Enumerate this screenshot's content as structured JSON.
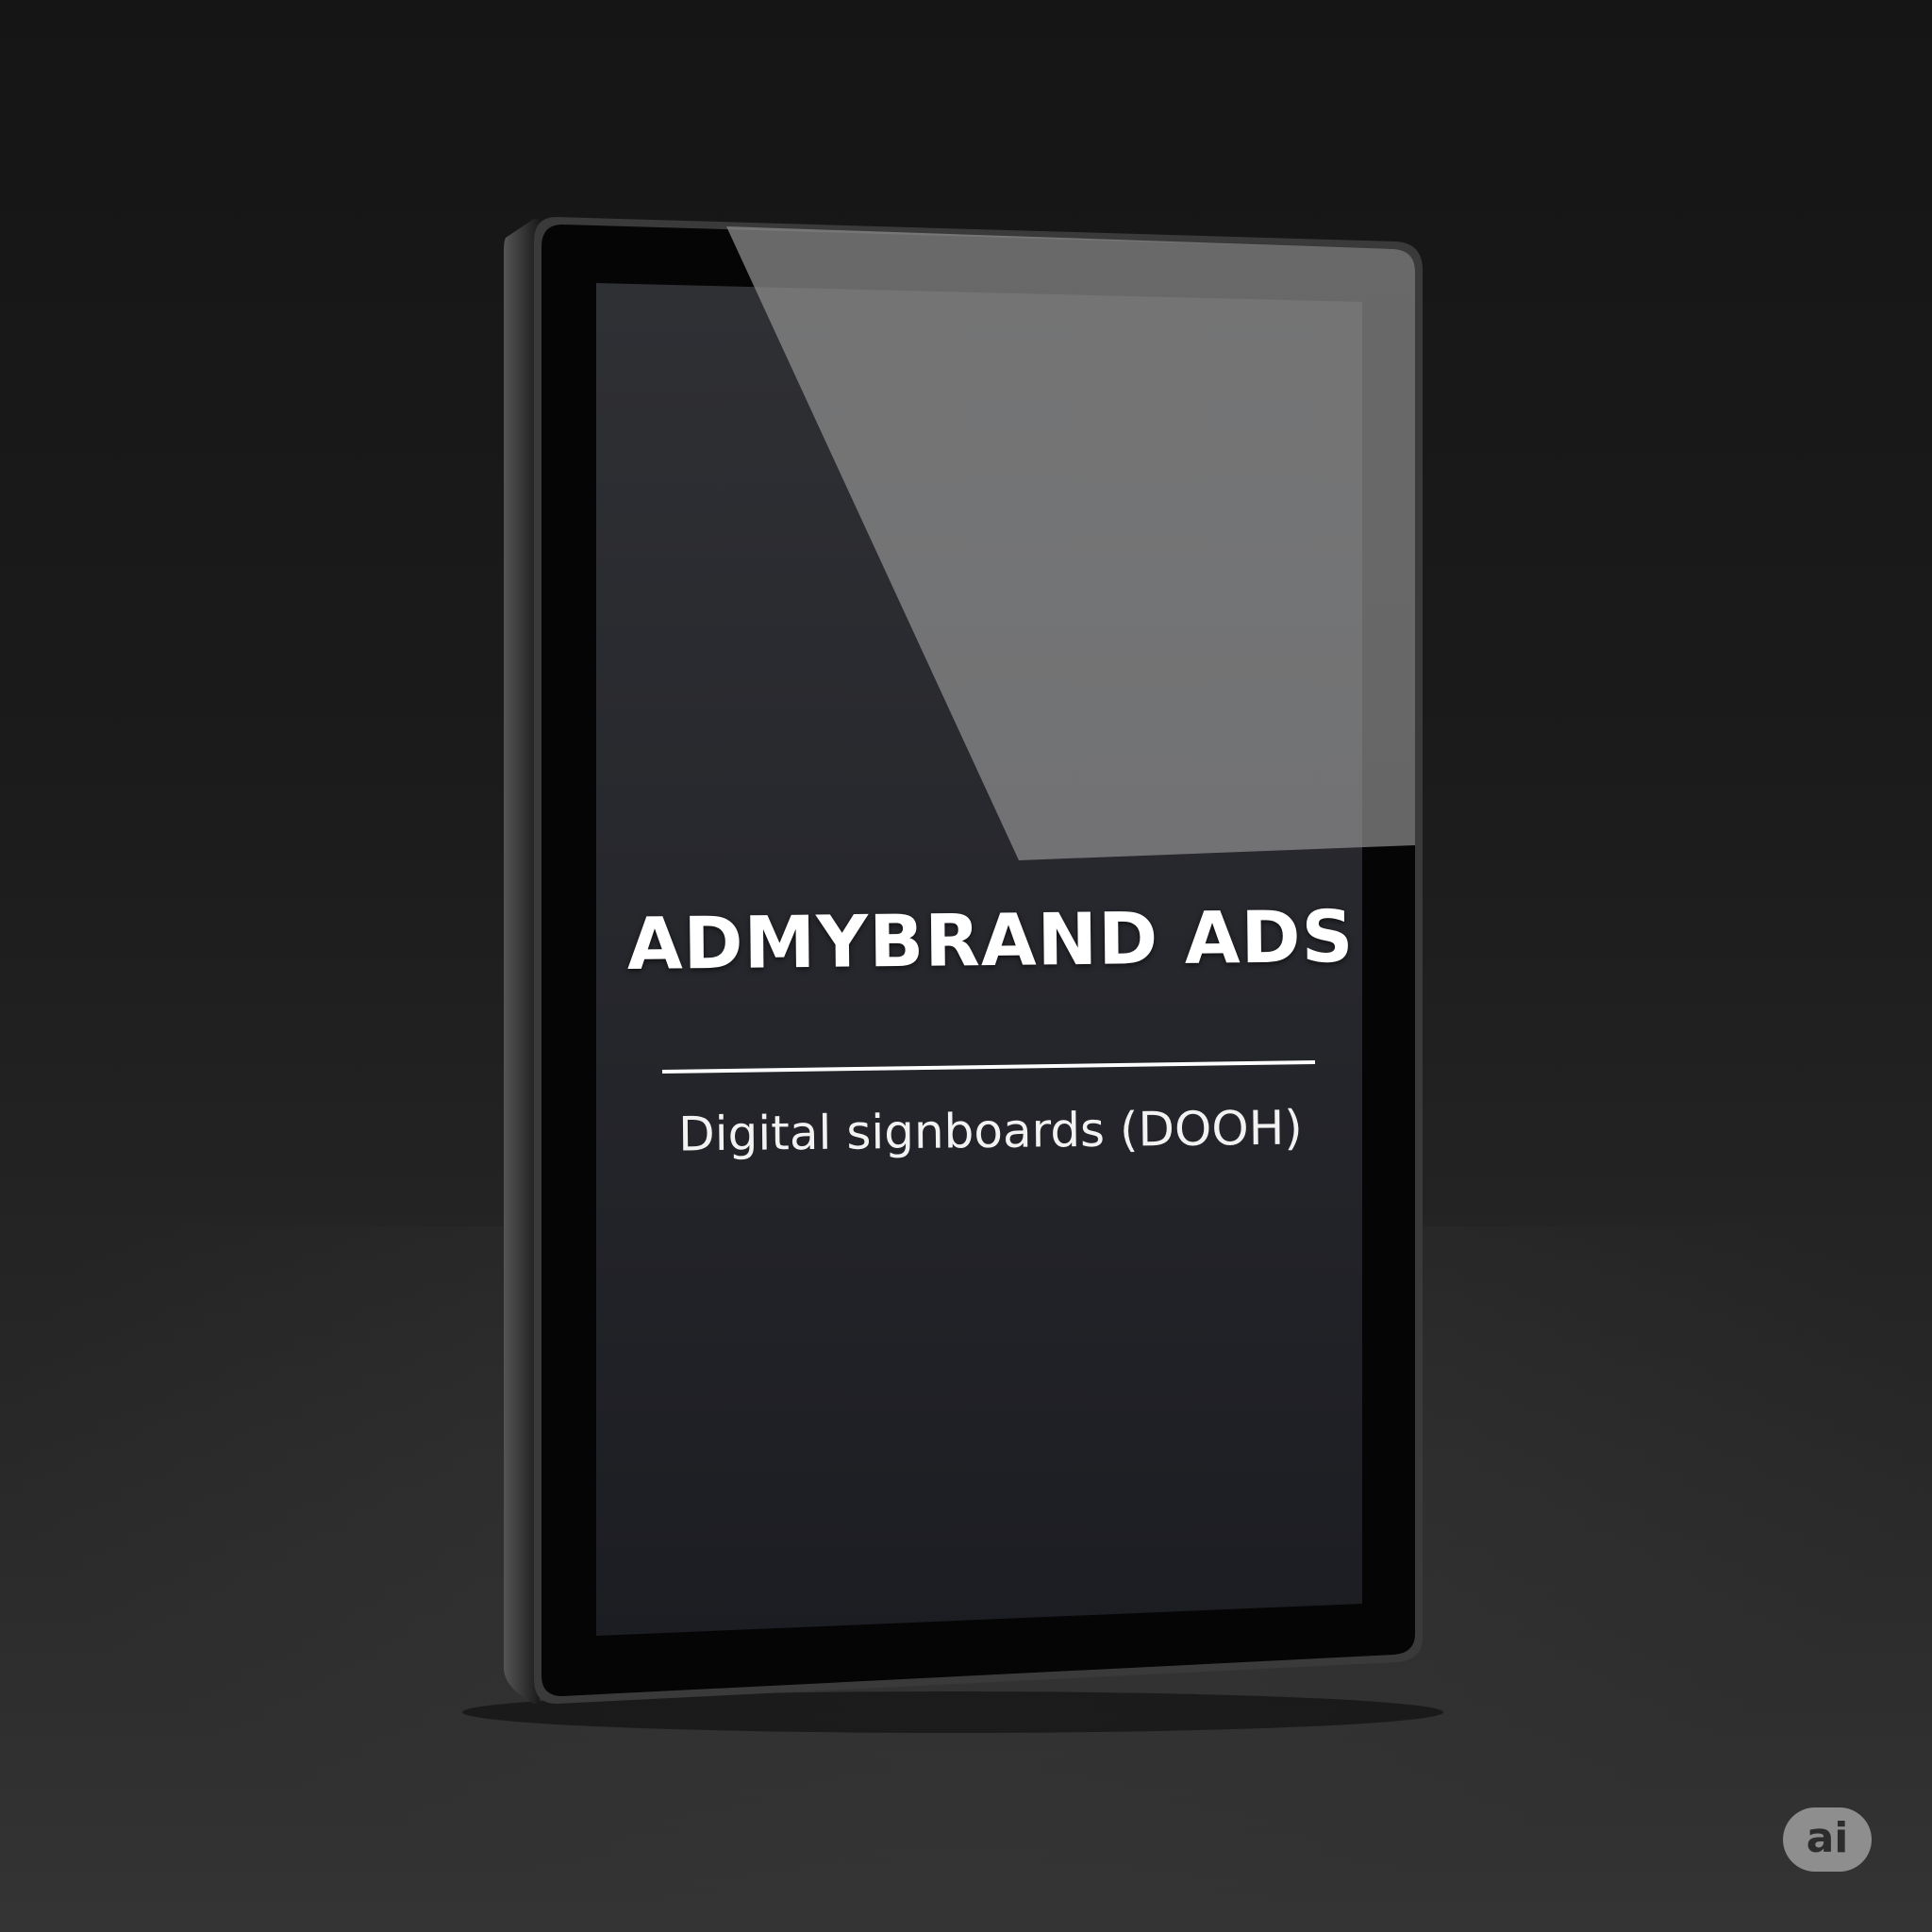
{
  "signboard": {
    "title": "ADMYBRAND ADS",
    "subtitle": "Digital signboards (DOOH)"
  },
  "badge": {
    "label": "ai"
  },
  "colors": {
    "background": "#1b1b1b",
    "bezel": "#050505",
    "screen": "#23242a",
    "text": "#ffffff"
  }
}
